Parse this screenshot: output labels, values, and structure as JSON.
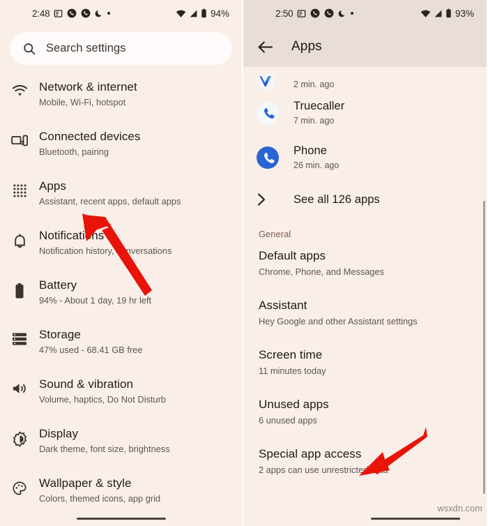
{
  "left_phone": {
    "status_bar": {
      "time": "2:48",
      "battery_percent": "94%",
      "icons_left": [
        "message-icon",
        "phone-call-icon",
        "phone-call-icon",
        "crescent-moon-icon",
        "dot-icon"
      ],
      "icons_right": [
        "wifi-icon",
        "signal-icon",
        "battery-icon"
      ]
    },
    "search": {
      "placeholder": "Search settings",
      "icon": "search-icon"
    },
    "settings": [
      {
        "icon": "wifi-icon",
        "title": "Network & internet",
        "subtitle": "Mobile, Wi-Fi, hotspot"
      },
      {
        "icon": "devices-icon",
        "title": "Connected devices",
        "subtitle": "Bluetooth, pairing"
      },
      {
        "icon": "apps-grid-icon",
        "title": "Apps",
        "subtitle": "Assistant, recent apps, default apps"
      },
      {
        "icon": "bell-icon",
        "title": "Notifications",
        "subtitle": "Notification history, conversations"
      },
      {
        "icon": "battery-icon",
        "title": "Battery",
        "subtitle": "94% - About 1 day, 19 hr left"
      },
      {
        "icon": "storage-icon",
        "title": "Storage",
        "subtitle": "47% used - 68.41 GB free"
      },
      {
        "icon": "volume-icon",
        "title": "Sound & vibration",
        "subtitle": "Volume, haptics, Do Not Disturb"
      },
      {
        "icon": "brightness-icon",
        "title": "Display",
        "subtitle": "Dark theme, font size, brightness"
      },
      {
        "icon": "palette-icon",
        "title": "Wallpaper & style",
        "subtitle": "Colors, themed icons, app grid"
      }
    ]
  },
  "right_phone": {
    "status_bar": {
      "time": "2:50",
      "battery_percent": "93%",
      "icons_left": [
        "message-icon",
        "phone-call-icon",
        "phone-call-icon",
        "crescent-moon-icon",
        "dot-icon"
      ],
      "icons_right": [
        "wifi-icon",
        "signal-icon",
        "battery-icon"
      ]
    },
    "app_bar": {
      "back_icon": "back-arrow-icon",
      "title": "Apps"
    },
    "recent_apps": [
      {
        "icon": "truecaller-icon",
        "name": "",
        "time": "2 min. ago"
      },
      {
        "icon": "truecaller-icon",
        "name": "Truecaller",
        "time": "7 min. ago"
      },
      {
        "icon": "phone-icon",
        "name": "Phone",
        "time": "26 min. ago"
      }
    ],
    "see_all": {
      "icon": "chevron-right-icon",
      "label": "See all 126 apps"
    },
    "section_general": "General",
    "general_items": [
      {
        "title": "Default apps",
        "subtitle": "Chrome, Phone, and Messages"
      },
      {
        "title": "Assistant",
        "subtitle": "Hey Google and other Assistant settings"
      },
      {
        "title": "Screen time",
        "subtitle": "11 minutes today"
      },
      {
        "title": "Unused apps",
        "subtitle": "6 unused apps"
      },
      {
        "title": "Special app access",
        "subtitle": "2 apps can use unrestricted data"
      }
    ]
  },
  "annotations": {
    "arrow_color": "#e81309",
    "left_arrow_target": "Apps",
    "right_arrow_target": "Special app access"
  },
  "watermark": "wsxdn.com",
  "colors": {
    "page_background": "#faeee9",
    "appbar_background": "#e9ddd7",
    "search_background": "#fffbfa",
    "title_text": "#1d1917",
    "subtitle_text": "#5d5450",
    "section_header_text": "#7a5a4e",
    "accent_blue": "#2a64d4",
    "scrollbar": "#a89e99"
  }
}
